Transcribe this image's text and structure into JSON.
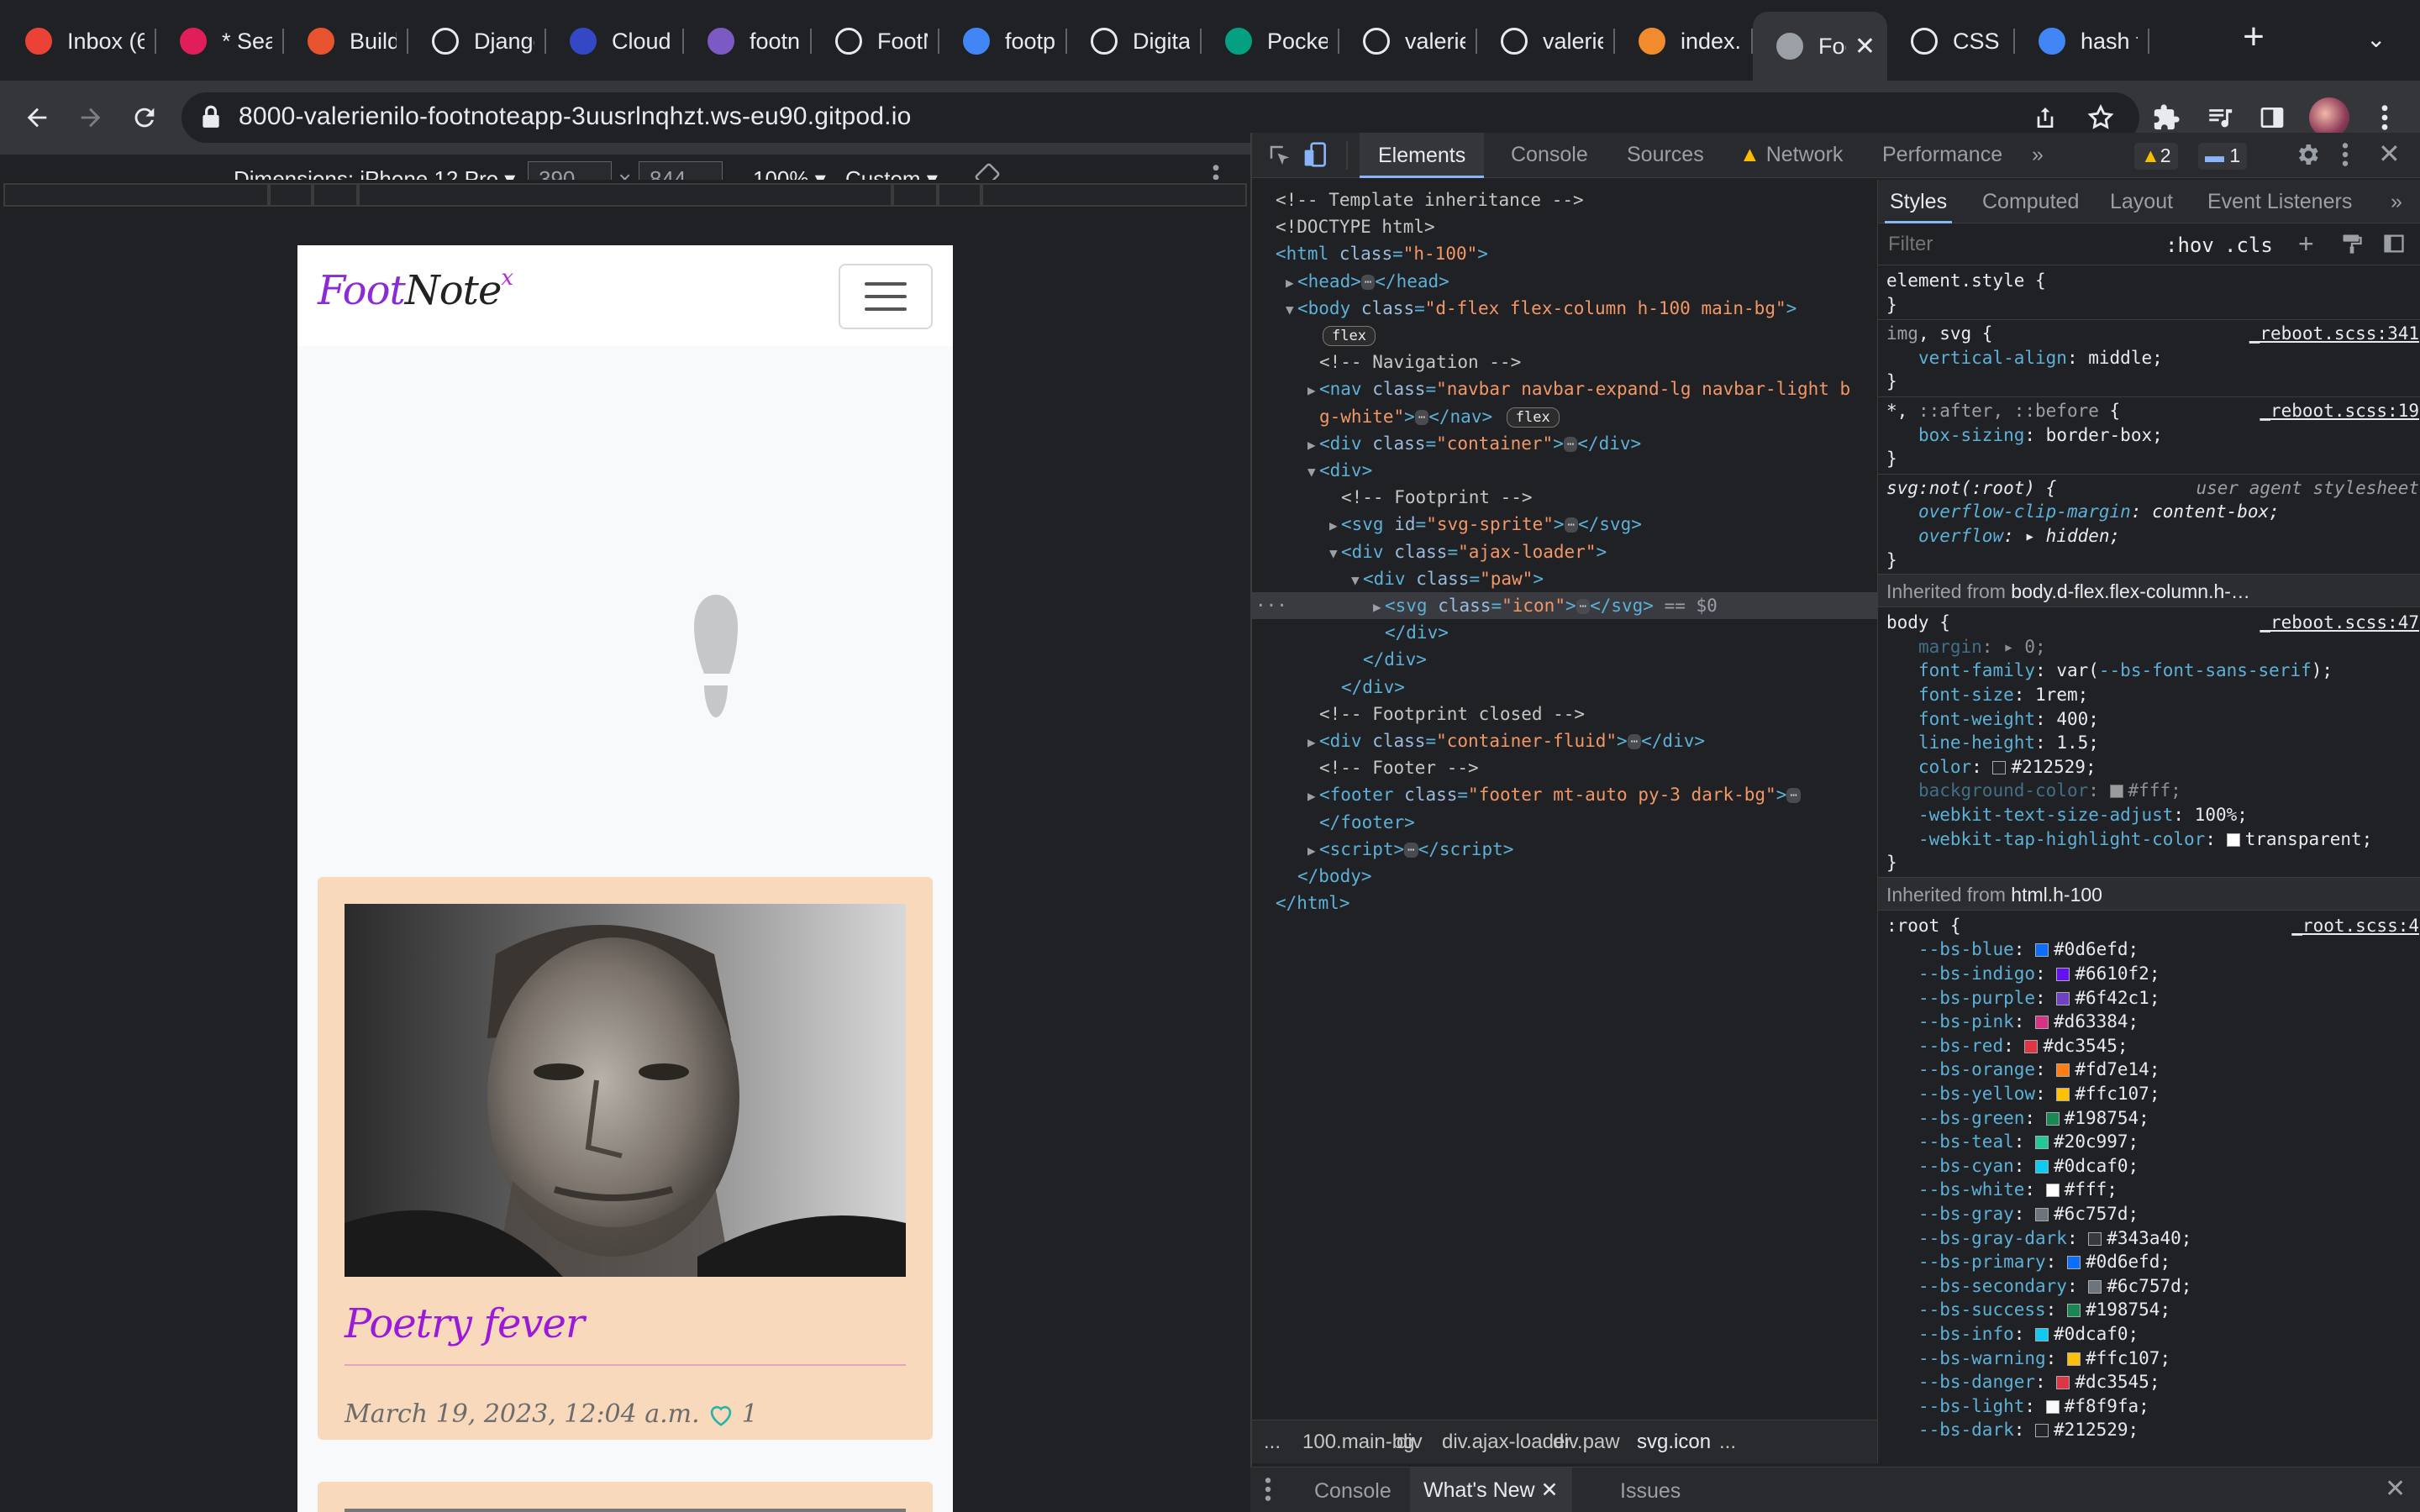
{
  "browser": {
    "tabs": [
      {
        "title": "Inbox (6",
        "icon": "gmail-icon",
        "color": "#ea4335"
      },
      {
        "title": "* Searc",
        "icon": "slack-icon",
        "color": "#e01e5a"
      },
      {
        "title": "Building",
        "icon": "record-icon",
        "color": "#e8532f"
      },
      {
        "title": "Django",
        "icon": "github-icon",
        "color": "#e8eaed"
      },
      {
        "title": "Cloudin",
        "icon": "cloudinary-icon",
        "color": "#3448c5"
      },
      {
        "title": "footnot",
        "icon": "heroku-icon",
        "color": "#7b5ac4"
      },
      {
        "title": "FootNo",
        "icon": "github-icon",
        "color": "#e8eaed"
      },
      {
        "title": "footprin",
        "icon": "google-icon",
        "color": "#4285f4"
      },
      {
        "title": "Digital",
        "icon": "is-icon",
        "color": "#e8eaed"
      },
      {
        "title": "Pocket",
        "icon": "pexels-icon",
        "color": "#05a081"
      },
      {
        "title": "valerien",
        "icon": "github-icon",
        "color": "#e8eaed"
      },
      {
        "title": "valerien",
        "icon": "github-icon",
        "color": "#e8eaed"
      },
      {
        "title": "index.h",
        "icon": "codeanywhere-icon",
        "color": "#f28b2d"
      },
      {
        "title": "Foo",
        "icon": "globe-icon",
        "color": "#9aa0a6"
      },
      {
        "title": "CSS SV",
        "icon": "settings-icon",
        "color": "#e8eaed"
      },
      {
        "title": "hash ta",
        "icon": "google-icon",
        "color": "#4285f4"
      }
    ],
    "active_tab_index": 13,
    "url": "8000-valerienilo-footnoteapp-3uusrlnqhzt.ws-eu90.gitpod.io"
  },
  "device_toolbar": {
    "dimensions_label": "Dimensions: iPhone 12 Pro",
    "width": "390",
    "height": "844",
    "zoom": "100%",
    "throttle": "Custom"
  },
  "app": {
    "brand_part1": "Foot",
    "brand_part2": "Note",
    "brand_sup": "x",
    "card": {
      "title": "Poetry fever",
      "date": "March 19, 2023, 12:04 a.m.",
      "likes": "1"
    }
  },
  "devtools": {
    "tabs": [
      "Elements",
      "Console",
      "Sources",
      "Network",
      "Performance"
    ],
    "warnings_count": "2",
    "messages_count": "1",
    "dom_lines": [
      {
        "indent": 0,
        "tri": "",
        "html": "<span class='cmt'>&lt;!-- Template inheritance --&gt;</span>"
      },
      {
        "indent": 0,
        "tri": "",
        "html": "<span class='cmt'>&lt;!DOCTYPE html&gt;</span>"
      },
      {
        "indent": 0,
        "tri": "",
        "html": "<span class='tag'>&lt;html</span> <span class='attr'>class</span><span class='tag'>=</span><span class='val'>\"h-100\"</span><span class='tag'>&gt;</span>"
      },
      {
        "indent": 1,
        "tri": "▶",
        "html": "<span class='tag'>&lt;head&gt;</span><span class='dots'>⋯</span><span class='tag'>&lt;/head&gt;</span>"
      },
      {
        "indent": 1,
        "tri": "▼",
        "html": "<span class='tag'>&lt;body</span> <span class='attr'>class</span><span class='tag'>=</span><span class='val'>\"d-flex flex-column h-100 main-bg\"</span><span class='tag'>&gt;</span>"
      },
      {
        "indent": 2,
        "tri": "",
        "html": "<span class='pill'>flex</span>"
      },
      {
        "indent": 2,
        "tri": "",
        "html": "<span class='cmt'>&lt;!-- Navigation --&gt;</span>"
      },
      {
        "indent": 2,
        "tri": "▶",
        "html": "<span class='tag'>&lt;nav</span> <span class='attr'>class</span><span class='tag'>=</span><span class='val'>\"navbar navbar-expand-lg navbar-light b</span>"
      },
      {
        "indent": 2,
        "tri": "",
        "html": "<span class='val'>g-white\"</span><span class='tag'>&gt;</span><span class='dots'>⋯</span><span class='tag'>&lt;/nav&gt;</span> <span class='pill'>flex</span>"
      },
      {
        "indent": 2,
        "tri": "▶",
        "html": "<span class='tag'>&lt;div</span> <span class='attr'>class</span><span class='tag'>=</span><span class='val'>\"container\"</span><span class='tag'>&gt;</span><span class='dots'>⋯</span><span class='tag'>&lt;/div&gt;</span>"
      },
      {
        "indent": 2,
        "tri": "▼",
        "html": "<span class='tag'>&lt;div&gt;</span>"
      },
      {
        "indent": 3,
        "tri": "",
        "html": "<span class='cmt'>&lt;!-- Footprint --&gt;</span>"
      },
      {
        "indent": 3,
        "tri": "▶",
        "html": "<span class='tag'>&lt;svg</span> <span class='attr'>id</span><span class='tag'>=</span><span class='val'>\"svg-sprite\"</span><span class='tag'>&gt;</span><span class='dots'>⋯</span><span class='tag'>&lt;/svg&gt;</span>"
      },
      {
        "indent": 3,
        "tri": "▼",
        "html": "<span class='tag'>&lt;div</span> <span class='attr'>class</span><span class='tag'>=</span><span class='val'>\"ajax-loader\"</span><span class='tag'>&gt;</span>"
      },
      {
        "indent": 4,
        "tri": "▼",
        "html": "<span class='tag'>&lt;div</span> <span class='attr'>class</span><span class='tag'>=</span><span class='val'>\"paw\"</span><span class='tag'>&gt;</span>"
      },
      {
        "indent": 5,
        "tri": "▶",
        "html": "<span class='tag'>&lt;svg</span> <span class='attr'>class</span><span class='tag'>=</span><span class='val'>\"icon\"</span><span class='tag'>&gt;</span><span class='dots'>⋯</span><span class='tag'>&lt;/svg&gt;</span> <span class='eq'>== $0</span>",
        "selected": true
      },
      {
        "indent": 5,
        "tri": "",
        "html": "<span class='tag'>&lt;/div&gt;</span>"
      },
      {
        "indent": 4,
        "tri": "",
        "html": "<span class='tag'>&lt;/div&gt;</span>"
      },
      {
        "indent": 3,
        "tri": "",
        "html": "<span class='tag'>&lt;/div&gt;</span>"
      },
      {
        "indent": 2,
        "tri": "",
        "html": "<span class='cmt'>&lt;!-- Footprint closed --&gt;</span>"
      },
      {
        "indent": 2,
        "tri": "▶",
        "html": "<span class='tag'>&lt;div</span> <span class='attr'>class</span><span class='tag'>=</span><span class='val'>\"container-fluid\"</span><span class='tag'>&gt;</span><span class='dots'>⋯</span><span class='tag'>&lt;/div&gt;</span>"
      },
      {
        "indent": 2,
        "tri": "",
        "html": "<span class='cmt'>&lt;!-- Footer --&gt;</span>"
      },
      {
        "indent": 2,
        "tri": "▶",
        "html": "<span class='tag'>&lt;footer</span> <span class='attr'>class</span><span class='tag'>=</span><span class='val'>\"footer mt-auto py-3 dark-bg\"</span><span class='tag'>&gt;</span><span class='dots'>⋯</span>"
      },
      {
        "indent": 2,
        "tri": "",
        "html": "<span class='tag'>&lt;/footer&gt;</span>"
      },
      {
        "indent": 2,
        "tri": "▶",
        "html": "<span class='tag'>&lt;script&gt;</span><span class='dots'>⋯</span><span class='tag'>&lt;/script&gt;</span>"
      },
      {
        "indent": 1,
        "tri": "",
        "html": "<span class='tag'>&lt;/body&gt;</span>"
      },
      {
        "indent": 0,
        "tri": "",
        "html": "<span class='tag'>&lt;/html&gt;</span>"
      }
    ],
    "breadcrumbs": [
      "...",
      "100.main-bg",
      "div",
      "div.ajax-loader",
      "div.paw",
      "svg.icon",
      "..."
    ],
    "styles_tabs": [
      "Styles",
      "Computed",
      "Layout",
      "Event Listeners"
    ],
    "filter_placeholder": "Filter",
    "filter_buttons": [
      ":hov",
      ".cls"
    ],
    "style_lines": [
      {
        "html": "<span class='sel-name'>element.style {</span>"
      },
      {
        "html": "<span class='sel-name'>}</span>"
      },
      {
        "html": "<span class='sel-name'><span style='color:#9aa0a6'>img</span>, svg {</span>",
        "src": "_reboot.scss:341",
        "sep": true
      },
      {
        "html": "  <span class='prop'>vertical-align</span>: <span class='pval'>middle;</span>"
      },
      {
        "html": "<span class='sel-name'>}</span>"
      },
      {
        "html": "<span class='sel-name'>*, <span style='color:#9aa0a6'>::after, ::before</span> {</span>",
        "src": "_reboot.scss:19",
        "sep": true
      },
      {
        "html": "  <span class='prop'>box-sizing</span>: <span class='pval'>border-box;</span>"
      },
      {
        "html": "<span class='sel-name'>}</span>"
      },
      {
        "html": "<span class='sel-name'><i>svg:not(:root) {</i></span>",
        "ua": "user agent stylesheet",
        "sep": true
      },
      {
        "html": "  <i><span class='prop'>overflow-clip-margin</span>: <span class='pval'>content-box;</span></i>"
      },
      {
        "html": "  <i><span class='prop'>overflow</span>: <span class='pval'>▸ hidden;</span></i>"
      },
      {
        "html": "<span class='sel-name'>}</span>"
      },
      {
        "inh": "Inherited from ",
        "inh_b": "body.d-flex.flex-column.h-…"
      },
      {
        "html": "<span class='sel-name'>body {</span>",
        "src": "_reboot.scss:47"
      },
      {
        "html": "  <span class='prop dim'>margin</span><span class='dim'>: ▸ 0;</span>"
      },
      {
        "html": "  <span class='prop'>font-family</span>: <span class='pval'>var(<span class='prop'>--bs-font-sans-serif</span>);</span>"
      },
      {
        "html": "  <span class='prop'>font-size</span>: <span class='pval'>1rem;</span>"
      },
      {
        "html": "  <span class='prop'>font-weight</span>: <span class='pval'>400;</span>"
      },
      {
        "html": "  <span class='prop'>line-height</span>: <span class='pval'>1.5;</span>"
      },
      {
        "html": "  <span class='prop'>color</span>: <span class='sw' style='background:#212529'></span><span class='pval'>#212529;</span>"
      },
      {
        "html": "  <span class='prop dim'>background-color</span><span class='dim'>: <span class='sw' style='background:#fff'></span>#fff;</span>"
      },
      {
        "html": "  <span class='prop'>-webkit-text-size-adjust</span>: <span class='pval'>100%;</span>"
      },
      {
        "html": "  <span class='prop'>-webkit-tap-highlight-color</span>: <span class='sw' style='background:#fff'></span><span class='pval'>transparent;</span>"
      },
      {
        "html": "<span class='sel-name'>}</span>"
      },
      {
        "inh": "Inherited from ",
        "inh_b": "html.h-100"
      },
      {
        "html": "<span class='sel-name'>:root {</span>",
        "src": "_root.scss:4"
      },
      {
        "html": "  <span class='prop'>--bs-blue</span>: <span class='sw' style='background:#0d6efd'></span><span class='pval'>#0d6efd;</span>"
      },
      {
        "html": "  <span class='prop'>--bs-indigo</span>: <span class='sw' style='background:#6610f2'></span><span class='pval'>#6610f2;</span>"
      },
      {
        "html": "  <span class='prop'>--bs-purple</span>: <span class='sw' style='background:#6f42c1'></span><span class='pval'>#6f42c1;</span>"
      },
      {
        "html": "  <span class='prop'>--bs-pink</span>: <span class='sw' style='background:#d63384'></span><span class='pval'>#d63384;</span>"
      },
      {
        "html": "  <span class='prop'>--bs-red</span>: <span class='sw' style='background:#dc3545'></span><span class='pval'>#dc3545;</span>"
      },
      {
        "html": "  <span class='prop'>--bs-orange</span>: <span class='sw' style='background:#fd7e14'></span><span class='pval'>#fd7e14;</span>"
      },
      {
        "html": "  <span class='prop'>--bs-yellow</span>: <span class='sw' style='background:#ffc107'></span><span class='pval'>#ffc107;</span>"
      },
      {
        "html": "  <span class='prop'>--bs-green</span>: <span class='sw' style='background:#198754'></span><span class='pval'>#198754;</span>"
      },
      {
        "html": "  <span class='prop'>--bs-teal</span>: <span class='sw' style='background:#20c997'></span><span class='pval'>#20c997;</span>"
      },
      {
        "html": "  <span class='prop'>--bs-cyan</span>: <span class='sw' style='background:#0dcaf0'></span><span class='pval'>#0dcaf0;</span>"
      },
      {
        "html": "  <span class='prop'>--bs-white</span>: <span class='sw' style='background:#fff'></span><span class='pval'>#fff;</span>"
      },
      {
        "html": "  <span class='prop'>--bs-gray</span>: <span class='sw' style='background:#6c757d'></span><span class='pval'>#6c757d;</span>"
      },
      {
        "html": "  <span class='prop'>--bs-gray-dark</span>: <span class='sw' style='background:#343a40'></span><span class='pval'>#343a40;</span>"
      },
      {
        "html": "  <span class='prop'>--bs-primary</span>: <span class='sw' style='background:#0d6efd'></span><span class='pval'>#0d6efd;</span>"
      },
      {
        "html": "  <span class='prop'>--bs-secondary</span>: <span class='sw' style='background:#6c757d'></span><span class='pval'>#6c757d;</span>"
      },
      {
        "html": "  <span class='prop'>--bs-success</span>: <span class='sw' style='background:#198754'></span><span class='pval'>#198754;</span>"
      },
      {
        "html": "  <span class='prop'>--bs-info</span>: <span class='sw' style='background:#0dcaf0'></span><span class='pval'>#0dcaf0;</span>"
      },
      {
        "html": "  <span class='prop'>--bs-warning</span>: <span class='sw' style='background:#ffc107'></span><span class='pval'>#ffc107;</span>"
      },
      {
        "html": "  <span class='prop'>--bs-danger</span>: <span class='sw' style='background:#dc3545'></span><span class='pval'>#dc3545;</span>"
      },
      {
        "html": "  <span class='prop'>--bs-light</span>: <span class='sw' style='background:#f8f9fa'></span><span class='pval'>#f8f9fa;</span>"
      },
      {
        "html": "  <span class='prop'>--bs-dark</span>: <span class='sw' style='background:#212529'></span><span class='pval'>#212529;</span>"
      }
    ],
    "drawer_tabs": [
      "Console",
      "What's New",
      "Issues"
    ]
  }
}
